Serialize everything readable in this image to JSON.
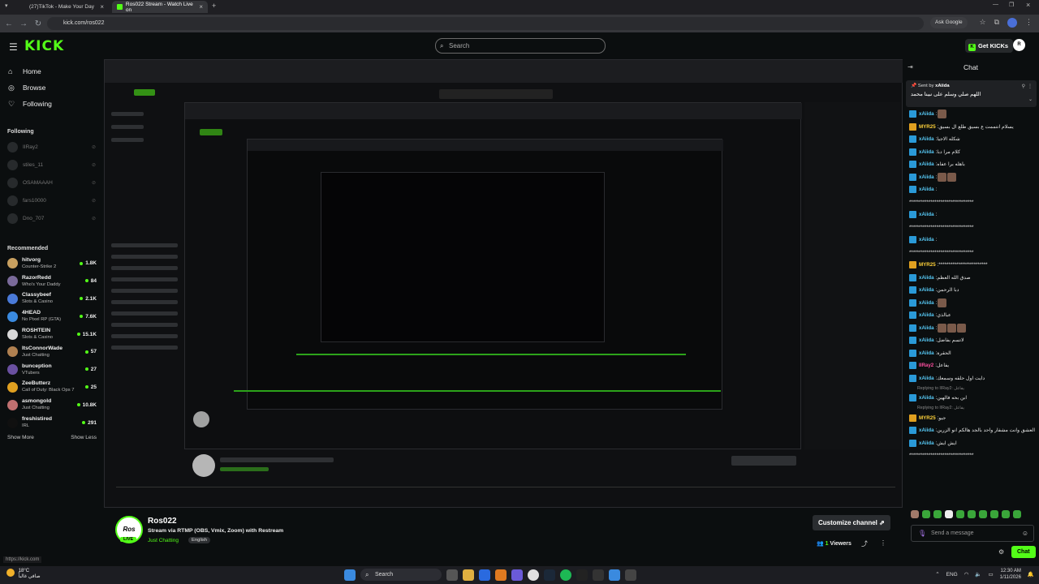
{
  "browser": {
    "tabs": [
      {
        "title": "(27)TikTok - Make Your Day"
      },
      {
        "title": "Ros022 Stream - Watch Live on"
      }
    ],
    "url": "kick.com/ros022",
    "ask_google": "Ask Google"
  },
  "header": {
    "logo": "KICK",
    "search_placeholder": "Search",
    "get_kicks": "Get KICKs",
    "brand_color": "#53fc18"
  },
  "sidebar": {
    "nav": [
      {
        "label": "Home",
        "icon": "home-icon"
      },
      {
        "label": "Browse",
        "icon": "compass-icon"
      },
      {
        "label": "Following",
        "icon": "heart-icon"
      }
    ],
    "following_title": "Following",
    "following": [
      {
        "name": "IIRay2"
      },
      {
        "name": "stiles_11"
      },
      {
        "name": "OSAMAAAH"
      },
      {
        "name": "fars10000"
      },
      {
        "name": "Dno_707"
      }
    ],
    "recommended_title": "Recommended",
    "recommended": [
      {
        "name": "hitvorg",
        "category": "Counter-Strike 2",
        "viewers": "1.8K",
        "color": "#c8a060"
      },
      {
        "name": "RazorRedd",
        "category": "Who's Your Daddy",
        "viewers": "84",
        "color": "#7a6a9a"
      },
      {
        "name": "Classybeef",
        "category": "Slots & Casino",
        "viewers": "2.1K",
        "color": "#4a7ad8"
      },
      {
        "name": "4HEAD",
        "category": "No Pixel RP (GTA)",
        "viewers": "7.6K",
        "color": "#3a8adf"
      },
      {
        "name": "ROSHTEIN",
        "category": "Slots & Casino",
        "viewers": "15.1K",
        "color": "#d8d8d8"
      },
      {
        "name": "ItsConnorWade",
        "category": "Just Chatting",
        "viewers": "57",
        "color": "#b08050"
      },
      {
        "name": "bunception",
        "category": "VTubers",
        "viewers": "27",
        "color": "#6a50a0"
      },
      {
        "name": "ZeeButterz",
        "category": "Call of Duty: Black Ops 7",
        "viewers": "25",
        "color": "#e0a020"
      },
      {
        "name": "asmongold",
        "category": "Just Chatting",
        "viewers": "10.8K",
        "color": "#c07070"
      },
      {
        "name": "freshistired",
        "category": "IRL",
        "viewers": "291",
        "color": "#101010"
      }
    ],
    "show_more": "Show More",
    "show_less": "Show Less"
  },
  "stream": {
    "channel": "Ros022",
    "avatar_text": "Ros",
    "live": "LIVE",
    "title": "Stream via RTMP (OBS, Vmix, Zoom) with Restream",
    "category": "Just Chatting",
    "language": "English",
    "customize": "Customize channel",
    "viewers_count": "1",
    "viewers_label": "Viewers"
  },
  "chat": {
    "title": "Chat",
    "pinned_by_label": "Sent by",
    "pinned_by": "xAiida",
    "pinned_message": "اللهم صلي وسلم على نبينا محمد",
    "messages": [
      {
        "user": "xAiida",
        "text": "",
        "color": "#57c9f6",
        "badge": "#2a9ad8",
        "emotes": 1
      },
      {
        "user": "MYR25",
        "text": "يسلام انتممت ع بسيق طلع ال بسيق",
        "color": "#ffd23a",
        "badge": "#e0a020",
        "emotes": 0
      },
      {
        "user": "xAiida",
        "text": "شكله الاجيا",
        "color": "#57c9f6",
        "badge": "#2a9ad8",
        "emotes": 0
      },
      {
        "user": "xAiida",
        "text": "كلام مرا دبا",
        "color": "#57c9f6",
        "badge": "#2a9ad8",
        "emotes": 0
      },
      {
        "user": "xAiida",
        "text": "باهله برا عفاه",
        "color": "#57c9f6",
        "badge": "#2a9ad8",
        "emotes": 0
      },
      {
        "user": "xAiida",
        "text": "",
        "color": "#57c9f6",
        "badge": "#2a9ad8",
        "emotes": 2
      },
      {
        "user": "xAiida",
        "text": "",
        "color": "#57c9f6",
        "badge": "#2a9ad8",
        "emotes": 0
      },
      {
        "user": "",
        "text": "*********************************",
        "color": "#eee",
        "badge": "",
        "emotes": 0
      },
      {
        "user": "xAiida",
        "text": "",
        "color": "#57c9f6",
        "badge": "#2a9ad8",
        "emotes": 0
      },
      {
        "user": "",
        "text": "*********************************",
        "color": "#eee",
        "badge": "",
        "emotes": 0
      },
      {
        "user": "xAiida",
        "text": "",
        "color": "#57c9f6",
        "badge": "#2a9ad8",
        "emotes": 0
      },
      {
        "user": "",
        "text": "*********************************",
        "color": "#eee",
        "badge": "",
        "emotes": 0
      },
      {
        "user": "MYR25",
        "text": "*************************",
        "color": "#ffd23a",
        "badge": "#e0a020",
        "emotes": 0
      },
      {
        "user": "xAiida",
        "text": "صدق الله العظم",
        "color": "#57c9f6",
        "badge": "#2a9ad8",
        "emotes": 0
      },
      {
        "user": "xAiida",
        "text": "دبا الرحمن",
        "color": "#57c9f6",
        "badge": "#2a9ad8",
        "emotes": 0
      },
      {
        "user": "xAiida",
        "text": "",
        "color": "#57c9f6",
        "badge": "#2a9ad8",
        "emotes": 1
      },
      {
        "user": "xAiida",
        "text": "عبالذي",
        "color": "#57c9f6",
        "badge": "#2a9ad8",
        "emotes": 0
      },
      {
        "user": "xAiida",
        "text": "",
        "color": "#57c9f6",
        "badge": "#2a9ad8",
        "emotes": 3
      },
      {
        "user": "xAiida",
        "text": "لاتسم بفاضل",
        "color": "#57c9f6",
        "badge": "#2a9ad8",
        "emotes": 0
      },
      {
        "user": "xAiida",
        "text": "الحقرة",
        "color": "#57c9f6",
        "badge": "#2a9ad8",
        "emotes": 0
      },
      {
        "user": "IIRay2",
        "text": "يفاعل",
        "color": "#ff4fa0",
        "badge": "#2a9ad8",
        "emotes": 0
      },
      {
        "user": "xAiida",
        "text": "دايت اول حلقه وسمعك",
        "color": "#57c9f6",
        "badge": "#2a9ad8",
        "emotes": 0
      },
      {
        "user": "",
        "text": "Replying to IIRay2: يفاعل",
        "color": "#888",
        "badge": "",
        "emotes": 0,
        "reply": true
      },
      {
        "user": "xAiida",
        "text": "ابن بحه فالهين",
        "color": "#57c9f6",
        "badge": "#2a9ad8",
        "emotes": 0
      },
      {
        "user": "",
        "text": "Replying to IIRay2: يفاعل",
        "color": "#888",
        "badge": "",
        "emotes": 0,
        "reply": true
      },
      {
        "user": "MYR25",
        "text": "جيو",
        "color": "#ffd23a",
        "badge": "#e0a020",
        "emotes": 0
      },
      {
        "user": "xAiida",
        "text": "تعالو عن العشق وانت مشفار واحد بالجد هالكم انو الزرين",
        "color": "#57c9f6",
        "badge": "#2a9ad8",
        "emotes": 0
      },
      {
        "user": "xAiida",
        "text": "ايش ايش",
        "color": "#57c9f6",
        "badge": "#2a9ad8",
        "emotes": 0
      },
      {
        "user": "",
        "text": "*********************************",
        "color": "#eee",
        "badge": "",
        "emotes": 0
      }
    ],
    "input_placeholder": "Send a message",
    "send": "Chat"
  },
  "status_url": "https://kick.com",
  "taskbar": {
    "weather_temp": "18°C",
    "weather_desc": "صافي غالباً",
    "search": "Search",
    "lang": "ENG",
    "time": "12:30 AM",
    "date": "1/11/2026"
  }
}
